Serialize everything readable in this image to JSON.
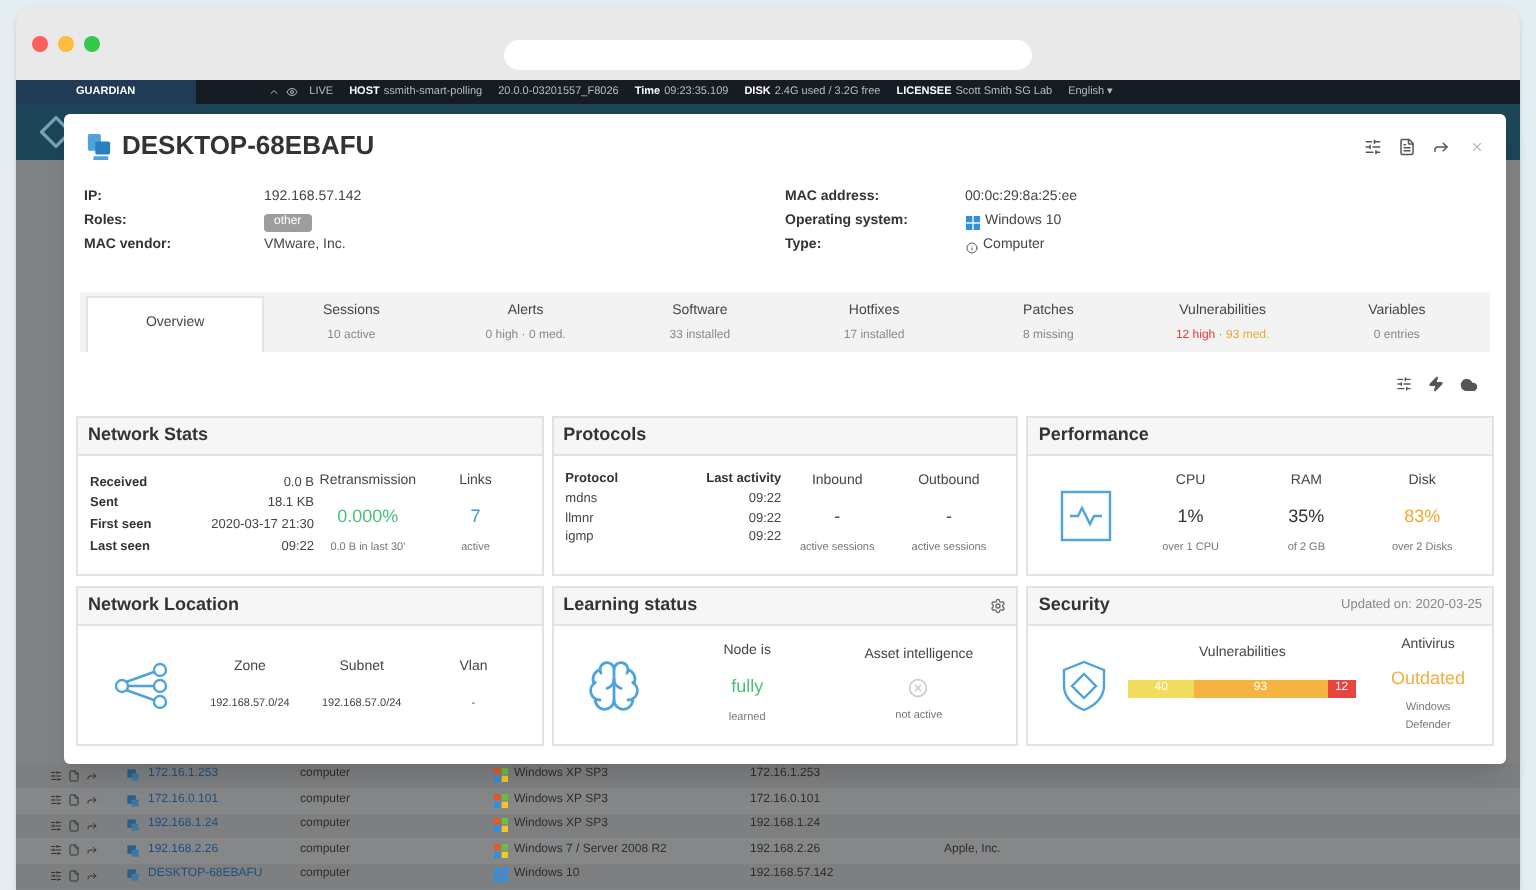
{
  "topbar": {
    "brand": "GUARDIAN",
    "live": "LIVE",
    "items": [
      {
        "label": "HOST",
        "value": "ssmith-smart-polling"
      },
      {
        "value": "20.0.0-03201557_F8026"
      },
      {
        "label": "Time",
        "value": "09:23:35.109"
      },
      {
        "label": "DISK",
        "value": "2.4G used / 3.2G free"
      },
      {
        "label": "LICENSEE",
        "value": "Scott Smith SG Lab"
      }
    ],
    "language": "English ▾"
  },
  "modal": {
    "title": "DESKTOP-68EBAFU",
    "info_left": [
      {
        "label": "IP:",
        "value": "192.168.57.142",
        "kind": "text"
      },
      {
        "label": "Roles:",
        "value": "other",
        "kind": "badge"
      },
      {
        "label": "MAC vendor:",
        "value": "VMware, Inc.",
        "kind": "text"
      }
    ],
    "info_right": [
      {
        "label": "MAC address:",
        "value": "00:0c:29:8a:25:ee",
        "kind": "text"
      },
      {
        "label": "Operating system:",
        "value": "Windows 10",
        "kind": "os"
      },
      {
        "label": "Type:",
        "value": "Computer",
        "kind": "info"
      }
    ],
    "tabs": [
      {
        "label": "Overview",
        "selected": true
      },
      {
        "label": "Sessions",
        "selected": false,
        "sub": [
          {
            "text": "10 active",
            "color": "#888888"
          }
        ]
      },
      {
        "label": "Alerts",
        "selected": false,
        "sub": [
          {
            "text": "0 high · 0 med.",
            "color": "#888888"
          }
        ]
      },
      {
        "label": "Software",
        "selected": false,
        "sub": [
          {
            "text": "33 installed",
            "color": "#888888"
          }
        ]
      },
      {
        "label": "Hotfixes",
        "selected": false,
        "sub": [
          {
            "text": "17 installed",
            "color": "#888888"
          }
        ]
      },
      {
        "label": "Patches",
        "selected": false,
        "sub": [
          {
            "text": "8 missing",
            "color": "#888888"
          }
        ]
      },
      {
        "label": "Vulnerabilities",
        "selected": false,
        "sub": [
          {
            "text": "12 high",
            "color": "#e53935"
          },
          {
            "text": " · "
          },
          {
            "text": "93 med.",
            "color": "#f0a830"
          }
        ]
      },
      {
        "label": "Variables",
        "selected": false,
        "sub": [
          {
            "text": "0 entries",
            "color": "#888888"
          }
        ]
      }
    ],
    "network_stats": {
      "title": "Network Stats",
      "rows": [
        {
          "label": "Received",
          "value": "0.0 B"
        },
        {
          "label": "Sent",
          "value": "18.1 KB"
        },
        {
          "label": "First seen",
          "value": "2020-03-17 21:30"
        },
        {
          "label": "Last seen",
          "value": "09:22"
        }
      ],
      "retransmission": {
        "label": "Retransmission",
        "value": "0.000%",
        "note": "0.0 B in last 30'"
      },
      "links": {
        "label": "Links",
        "value": "7",
        "note": "active"
      }
    },
    "protocols": {
      "title": "Protocols",
      "columns": [
        "Protocol",
        "Last activity"
      ],
      "rows": [
        [
          "mdns",
          "09:22"
        ],
        [
          "llmnr",
          "09:22"
        ],
        [
          "igmp",
          "09:22"
        ]
      ],
      "inbound": {
        "label": "Inbound",
        "value": "-",
        "note": "active sessions"
      },
      "outbound": {
        "label": "Outbound",
        "value": "-",
        "note": "active sessions"
      }
    },
    "performance": {
      "title": "Performance",
      "metrics": [
        {
          "label": "CPU",
          "value": "1%",
          "note": "over 1 CPU",
          "color": "#333333"
        },
        {
          "label": "RAM",
          "value": "35%",
          "note": "of 2 GB",
          "color": "#333333"
        },
        {
          "label": "Disk",
          "value": "83%",
          "note": "over 2 Disks",
          "color": "#f0a830"
        }
      ]
    },
    "network_location": {
      "title": "Network Location",
      "columns": [
        {
          "label": "Zone",
          "value": "192.168.57.0/24"
        },
        {
          "label": "Subnet",
          "value": "192.168.57.0/24"
        },
        {
          "label": "Vlan",
          "value": "-"
        }
      ]
    },
    "learning_status": {
      "title": "Learning status",
      "node": {
        "label": "Node is",
        "value": "fully",
        "note": "learned"
      },
      "asset_intelligence": {
        "label": "Asset intelligence",
        "note": "not active",
        "active": false
      }
    },
    "security": {
      "title": "Security",
      "updated": "Updated on: 2020-03-25",
      "vulnerabilities": {
        "label": "Vulnerabilities",
        "segments": [
          {
            "value": "40",
            "color": "#f2dc5d"
          },
          {
            "value": "93",
            "color": "#f5b342"
          },
          {
            "value": "12",
            "color": "#e8453c"
          }
        ]
      },
      "antivirus": {
        "label": "Antivirus",
        "value": "Outdated",
        "note": "Windows Defender"
      }
    }
  },
  "rows": [
    {
      "ip": "172.16.1.253",
      "type": "computer",
      "os": "Windows XP SP3",
      "kind": "xp",
      "address": "172.16.1.253"
    },
    {
      "ip": "172.16.0.101",
      "type": "computer",
      "os": "Windows XP SP3",
      "kind": "xp",
      "address": "172.16.0.101"
    },
    {
      "ip": "192.168.1.24",
      "type": "computer",
      "os": "Windows XP SP3",
      "kind": "xp",
      "address": "192.168.1.24"
    },
    {
      "ip": "192.168.2.26",
      "type": "computer",
      "os": "Windows 7 / Server 2008 R2",
      "kind": "xp",
      "address": "192.168.2.26",
      "vendor": "Apple, Inc."
    },
    {
      "ip": "DESKTOP-68EBAFU",
      "type": "computer",
      "os": "Windows 10",
      "kind": "win10",
      "address": "192.168.57.142"
    }
  ]
}
